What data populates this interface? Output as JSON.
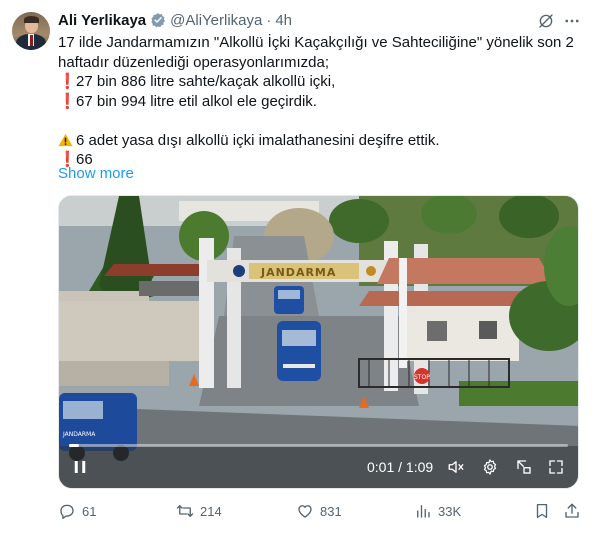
{
  "author": {
    "name": "Ali Yerlikaya",
    "handle": "@AliYerlikaya",
    "separator": "·",
    "time": "4h"
  },
  "tweet": {
    "line1": "17 ilde Jandarmamızın \"Alkollü İçki Kaçakçılığı ve Sahteciliğine\" yönelik son 2",
    "line2": "haftadır düzenlediği operasyonlarımızda;",
    "line3": "27 bin 886 litre sahte/kaçak alkollü içki,",
    "line4": "67 bin 994 litre etil alkol ele geçirdik.",
    "line5": "6 adet yasa dışı alkollü içki imalathanesini deşifre ettik.",
    "line6": "66",
    "exclamation": "❗",
    "show_more": "Show more"
  },
  "media": {
    "sign_text": "JANDARMA",
    "van_plate": "JANDARMA",
    "gate_sign": "STOP",
    "time_display": "0:01 / 1:09",
    "progress": 0.02
  },
  "actions": {
    "replies": "61",
    "reposts": "214",
    "likes": "831",
    "views": "33K"
  },
  "colors": {
    "link": "#1d9bf0",
    "muted": "#536471",
    "verified": "#829aab",
    "alert": "#e0112b"
  },
  "icons": [
    "verified-badge-icon",
    "grok-icon",
    "more-icon",
    "warning-icon",
    "play-icon",
    "mute-icon",
    "settings-icon",
    "picture-in-picture-icon",
    "fullscreen-icon",
    "reply-icon",
    "repost-icon",
    "like-icon",
    "views-icon",
    "bookmark-icon",
    "share-icon"
  ]
}
